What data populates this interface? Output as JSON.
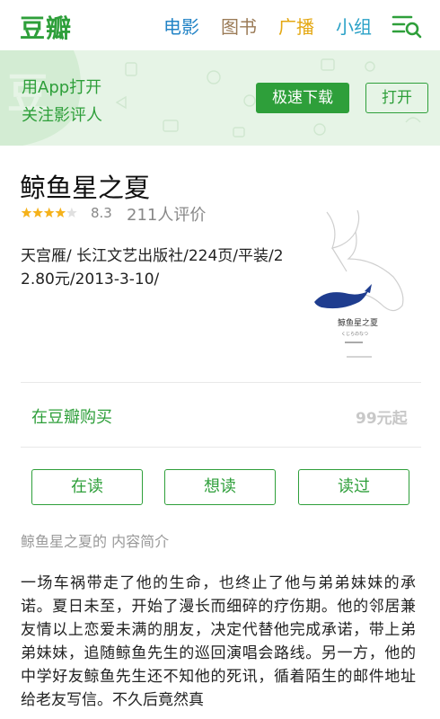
{
  "header": {
    "logo": "豆瓣",
    "nav": [
      "电影",
      "图书",
      "广播",
      "小组"
    ],
    "menu_icon": "menu-search-icon",
    "colors": {
      "brand": "#2e9f3a",
      "movie": "#2384c6",
      "book": "#9b7b57",
      "radio": "#e4a813",
      "group": "#2aa1c7"
    }
  },
  "banner": {
    "line1": "用App打开",
    "line2": "关注影评人",
    "download_label": "极速下载",
    "open_label": "打开",
    "background": "#e6f4e6"
  },
  "book": {
    "title": "鲸鱼星之夏",
    "stars": 4,
    "rating": "8.3",
    "rating_count": "211人评价",
    "meta": "天宫雁/ 长江文艺出版社/224页/平装/22.80元/2013-3-10/",
    "cover_title": "鲸鱼星之夏",
    "cover_subtitle": "くじらのなつ"
  },
  "purchase": {
    "label": "在豆瓣购买",
    "price": "99元起"
  },
  "status_buttons": [
    "在读",
    "想读",
    "读过"
  ],
  "intro": {
    "heading": "鲸鱼星之夏的 内容简介",
    "text": "一场车祸带走了他的生命，也终止了他与弟弟妹妹的承诺。夏日未至，开始了漫长而细碎的疗伤期。他的邻居兼友情以上恋爱未满的朋友，决定代替他完成承诺，带上弟弟妹妹，追随鲸鱼先生的巡回演唱会路线。另一方，他的中学好友鲸鱼先生还不知他的死讯，循着陌生的邮件地址给老友写信。不久后竟然真"
  }
}
